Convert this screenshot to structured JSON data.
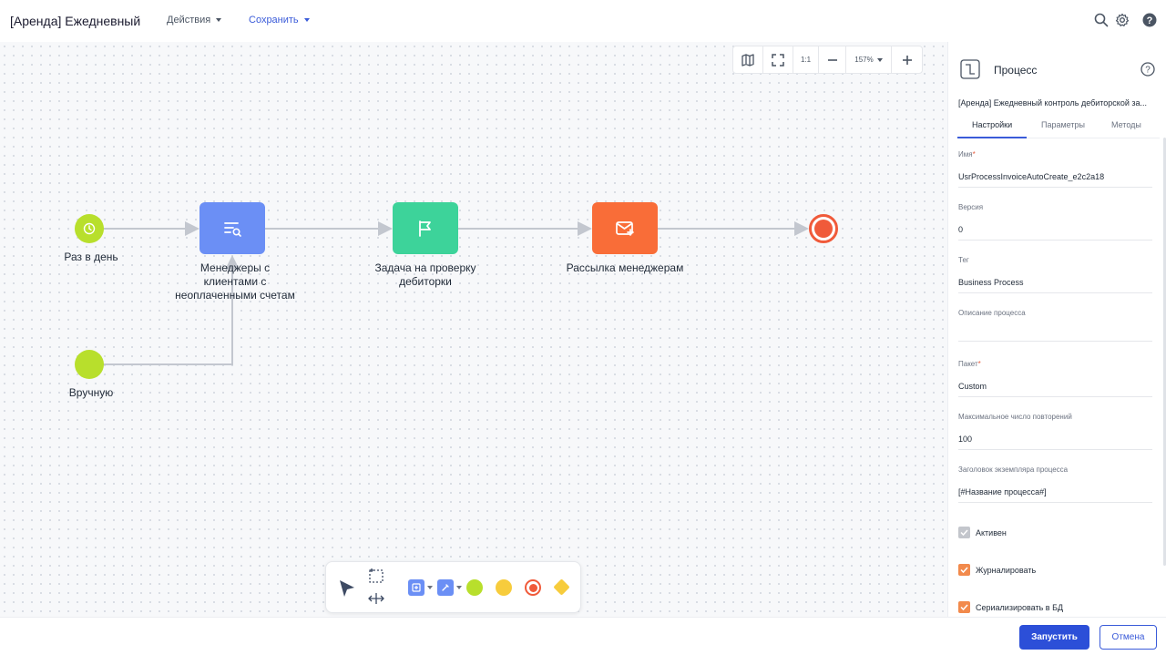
{
  "header": {
    "title": "[Аренда] Ежедневный",
    "actions_label": "Действия",
    "save_label": "Сохранить",
    "icons": [
      "search-icon",
      "gear-icon",
      "help-icon"
    ]
  },
  "diagram": {
    "nodes": {
      "timer_start": {
        "label": "Раз в день",
        "icon": "clock-icon",
        "color": "#b8df2c"
      },
      "read_data": {
        "label_lines": [
          "Менеджеры с",
          "клиентами с",
          "неоплаченными счетам"
        ],
        "icon": "search-list-icon",
        "color": "#6b8ff5"
      },
      "user_task": {
        "label_lines": [
          "Задача на проверку",
          "дебиторки"
        ],
        "icon": "flag-icon",
        "color": "#3dd39a"
      },
      "send_email": {
        "label": "Рассылка менеджерам",
        "icon": "email-icon",
        "color": "#f96d38"
      },
      "end": {
        "icon": "end-event-icon",
        "color": "#f05a3a"
      },
      "manual_start": {
        "label": "Вручную",
        "color": "#b8df2c"
      }
    }
  },
  "zoom_toolbar": {
    "one_to_one": "1:1",
    "zoom_level": "157%",
    "icons": [
      "map-icon",
      "fullscreen-icon",
      "zoom-out-icon",
      "zoom-in-icon"
    ]
  },
  "palette": {
    "items": [
      "pointer-icon",
      "lasso-select-icon",
      "space-tool-icon",
      "add-task-icon",
      "script-task-icon",
      "start-event-icon",
      "intermediate-event-icon",
      "end-event-icon",
      "gateway-icon"
    ],
    "colors": {
      "start": "#b8df2c",
      "intermediate": "#f7cc3c",
      "end": "#f05a3a",
      "gateway": "#f7cc3c",
      "task": "#6b8ff5"
    }
  },
  "panel": {
    "title": "Процесс",
    "subtitle": "[Аренда] Ежедневный контроль дебиторской за...",
    "tabs": [
      "Настройки",
      "Параметры",
      "Методы"
    ],
    "active_tab": "Настройки",
    "fields": [
      {
        "label": "Имя",
        "required": "*",
        "value": "UsrProcessInvoiceAutoCreate_e2c2a18"
      },
      {
        "label": "Версия",
        "required": "",
        "value": "0"
      },
      {
        "label": "Тег",
        "required": "",
        "value": "Business Process"
      },
      {
        "label": "Описание процесса",
        "required": "",
        "value": ""
      },
      {
        "label": "Пакет",
        "required": "*",
        "value": "Custom"
      },
      {
        "label": "Максимальное число повторений",
        "required": "",
        "value": "100"
      },
      {
        "label": "Заголовок экземпляра процесса",
        "required": "",
        "value": "[#Название процесса#]"
      }
    ],
    "checkboxes": [
      {
        "label": "Активен",
        "checked": true,
        "disabled": true
      },
      {
        "label": "Журналировать",
        "checked": true,
        "disabled": false
      },
      {
        "label": "Сериализировать в БД",
        "checked": true,
        "disabled": false
      }
    ],
    "checkbox_color": "#f28a4c"
  },
  "footer": {
    "run_label": "Запустить",
    "cancel_label": "Отмена"
  }
}
